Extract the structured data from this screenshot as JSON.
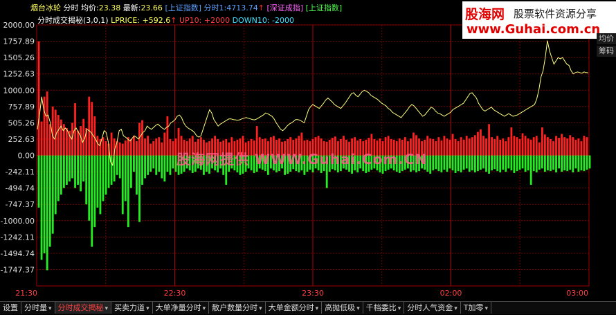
{
  "header": {
    "stock": "烟台冰轮",
    "mode": "分时",
    "avg_label": "均价:",
    "avg_value": "23.38",
    "latest_label": "最新:",
    "latest_value": "23.66",
    "index1": "[上证指数]",
    "time1_label": "分时1:",
    "time1_value": "4713.74",
    "up_arrow": "↑",
    "index2": "[深证成指]",
    "index3": "[上证指数]"
  },
  "indicator": {
    "name": "分时成交揭秘(3,0,1)",
    "lprice": "LPRICE: +592.6",
    "up": "UP10: +2000",
    "down": "DOWN10: -2000"
  },
  "logo": {
    "name": "股海网",
    "slogan": "股票软件资源分享",
    "url": "www.Guhai.com.cn"
  },
  "watermark": "股海网提供 WWW.Guhai.Com.CN",
  "side_buttons": [
    "均价",
    "筹码"
  ],
  "colors": {
    "up_bar": "#ff2020",
    "down_bar": "#22ee22",
    "price_line": "#ffff80",
    "grid": "#7a0000",
    "axis_text": "#e0e0e0"
  },
  "tabs": [
    {
      "label": "设置"
    },
    {
      "label": "分时量"
    },
    {
      "label": "分时成交揭秘"
    },
    {
      "label": "买卖力道"
    },
    {
      "label": "大单净量分时"
    },
    {
      "label": "散户数量分时"
    },
    {
      "label": "大单金额分时"
    },
    {
      "label": "高抛低吸"
    },
    {
      "label": "千档委比"
    },
    {
      "label": "分时人气资金"
    },
    {
      "label": "T加零"
    }
  ],
  "chart_data": {
    "type": "bar",
    "y_ticks": [
      "2000.00",
      "1757.89",
      "1505.26",
      "1252.63",
      "1000.00",
      "757.89",
      "505.26",
      "252.63",
      "0.00",
      "-242.11",
      "-494.74",
      "-747.37",
      "-1000.00",
      "-1242.11",
      "-1494.74",
      "-1747.37"
    ],
    "x_ticks": [
      "21:30",
      "22:30",
      "23:30",
      "02:00",
      "03:00"
    ],
    "ylim": [
      -2000,
      2000
    ],
    "series": [
      {
        "label": "buy",
        "values": [
          1750,
          520,
          900,
          980,
          480,
          750,
          700,
          620,
          550,
          480,
          420,
          380,
          500,
          800,
          380,
          450,
          560,
          420,
          900,
          820,
          600,
          300,
          250,
          280,
          220,
          180,
          350,
          260,
          220,
          200,
          180,
          230,
          280,
          250,
          300,
          220,
          500,
          540,
          260,
          300,
          180,
          220,
          260,
          280,
          200,
          350,
          600,
          250,
          220,
          260,
          420,
          300,
          240,
          220,
          260,
          300,
          210,
          250,
          280,
          240,
          200,
          220,
          260,
          300,
          250,
          210,
          230,
          250,
          200,
          280,
          220,
          240,
          260,
          300,
          200,
          220,
          250,
          230,
          450,
          280,
          250,
          260,
          220,
          280,
          300,
          240,
          260,
          210,
          220,
          250,
          280,
          240,
          260,
          300,
          350,
          230,
          240,
          220,
          250,
          280,
          300,
          260,
          220,
          210,
          240,
          270,
          290,
          220,
          250,
          300,
          240,
          210,
          260,
          280,
          230,
          250,
          220,
          240,
          270,
          330,
          250,
          230,
          260,
          220,
          280,
          300,
          250,
          240,
          220,
          260,
          240,
          280,
          220,
          260,
          350,
          310,
          260,
          220,
          240,
          300,
          260,
          250,
          220,
          280,
          230,
          300,
          260,
          240,
          330,
          250,
          220,
          280,
          240,
          300,
          260,
          280,
          310,
          360,
          400,
          300,
          260,
          480,
          280,
          250,
          300,
          240,
          260,
          220,
          280,
          430,
          300,
          280,
          250,
          340,
          300,
          260,
          240,
          280,
          300,
          200,
          430,
          320,
          280,
          250,
          220,
          300,
          270,
          330,
          280,
          260,
          310,
          280,
          240,
          260,
          220,
          300,
          280
        ]
      },
      {
        "label": "sell",
        "values": [
          -800,
          -1600,
          -1500,
          -1760,
          -1400,
          -1200,
          -900,
          -700,
          -600,
          -500,
          -450,
          -400,
          -350,
          -500,
          -450,
          -550,
          -400,
          -750,
          -1000,
          -1400,
          -1100,
          -800,
          -900,
          -700,
          -600,
          -500,
          -450,
          -400,
          -300,
          -350,
          -900,
          -700,
          -1100,
          -500,
          -250,
          -600,
          -1020,
          -450,
          -350,
          -300,
          -250,
          -200,
          -300,
          -250,
          -350,
          -400,
          -250,
          -300,
          -200,
          -250,
          -300,
          -280,
          -250,
          -200,
          -230,
          -270,
          -250,
          -200,
          -220,
          -300,
          -250,
          -280,
          -200,
          -230,
          -260,
          -200,
          -300,
          -450,
          -250,
          -200,
          -230,
          -260,
          -300,
          -280,
          -250,
          -200,
          -230,
          -270,
          -250,
          -200,
          -220,
          -240,
          -300,
          -200,
          -230,
          -260,
          -240,
          -200,
          -300,
          -280,
          -250,
          -210,
          -240,
          -260,
          -230,
          -300,
          -250,
          -220,
          -260,
          -200,
          -230,
          -270,
          -240,
          -500,
          -250,
          -210,
          -230,
          -260,
          -240,
          -200,
          -220,
          -250,
          -280,
          -230,
          -260,
          -200,
          -240,
          -270,
          -250,
          -220,
          -200,
          -230,
          -260,
          -280,
          -240,
          -220,
          -200,
          -230,
          -250,
          -270,
          -240,
          -220,
          -200,
          -250,
          -230,
          -260,
          -240,
          -200,
          -220,
          -250,
          -280,
          -230,
          -210,
          -240,
          -260,
          -220,
          -250,
          -200,
          -230,
          -270,
          -240,
          -260,
          -220,
          -200,
          -250,
          -230,
          -260,
          -240,
          -220,
          -200,
          -250,
          -280,
          -230,
          -210,
          -240,
          -260,
          -220,
          -250,
          -200,
          -230,
          -270,
          -240,
          -220,
          -200,
          -250,
          -230,
          -450,
          -240,
          -260,
          -220,
          -200,
          -250,
          -230,
          -240,
          -220,
          -260,
          -200,
          -250,
          -230,
          -240,
          -220,
          -260,
          -200,
          -250,
          -230,
          -240,
          -220,
          -200
        ]
      },
      {
        "label": "price",
        "values": [
          400,
          620,
          900,
          700,
          600,
          620,
          500,
          300,
          250,
          350,
          400,
          450,
          380,
          420,
          380,
          300,
          250,
          380,
          420,
          360,
          300,
          200,
          260,
          400,
          380,
          350,
          300,
          250,
          180,
          150,
          260,
          380,
          350,
          200,
          -100,
          -150,
          100,
          200,
          380,
          400,
          300,
          280,
          250,
          220,
          260,
          300,
          280,
          250,
          300,
          350,
          380,
          450,
          420,
          400,
          430,
          460,
          480,
          450,
          420,
          400,
          430,
          450,
          500,
          520,
          550,
          600,
          620,
          580,
          500,
          450,
          420,
          400,
          380,
          350,
          300,
          280,
          300,
          400,
          500,
          600,
          700,
          650,
          550,
          500,
          450,
          480,
          500,
          520,
          540,
          560,
          560,
          550,
          545,
          540,
          545,
          560,
          570,
          580,
          570,
          560,
          550,
          545,
          560,
          580,
          600,
          620,
          650,
          640,
          620,
          600,
          560,
          500,
          450,
          400,
          380,
          410,
          450,
          480,
          500,
          520,
          550,
          550,
          540,
          520,
          500,
          600,
          700,
          750,
          780,
          760,
          740,
          720,
          760,
          800,
          850,
          880,
          850,
          820,
          780,
          760,
          740,
          720,
          760,
          800,
          850,
          900,
          950,
          960,
          920,
          900,
          940,
          980,
          1000,
          980,
          960,
          920,
          900,
          880,
          860,
          830,
          800,
          780,
          760,
          720,
          700,
          660,
          640,
          620,
          600,
          580,
          620,
          660,
          700,
          750,
          780,
          760,
          720,
          680,
          640,
          600,
          620,
          660,
          700,
          740,
          720,
          680,
          650,
          640,
          620,
          600,
          620,
          640,
          660,
          700,
          720,
          740,
          760,
          780,
          800,
          850,
          900,
          950,
          960,
          920,
          880,
          800,
          750,
          700,
          680,
          700,
          720,
          740,
          700,
          680,
          660,
          640,
          620,
          600,
          620,
          640,
          620,
          600,
          610,
          620,
          640,
          660,
          680,
          700,
          720,
          740,
          760,
          780,
          860,
          1000,
          1200,
          1300,
          1500,
          1760,
          1600,
          1500,
          1400,
          1450,
          1500,
          1480,
          1500,
          1450,
          1400,
          1380,
          1300,
          1250,
          1270,
          1280,
          1270,
          1260,
          1280,
          1270,
          1265
        ]
      }
    ]
  }
}
